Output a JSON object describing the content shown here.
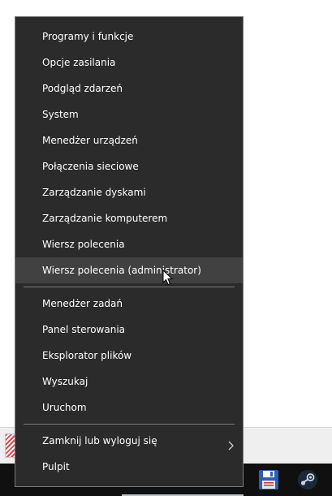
{
  "menu": {
    "group1": [
      {
        "label": "Programy i funkcje"
      },
      {
        "label": "Opcje zasilania"
      },
      {
        "label": "Podgląd zdarzeń"
      },
      {
        "label": "System"
      },
      {
        "label": "Menedżer urządzeń"
      },
      {
        "label": "Połączenia sieciowe"
      },
      {
        "label": "Zarządzanie dyskami"
      },
      {
        "label": "Zarządzanie komputerem"
      },
      {
        "label": "Wiersz polecenia"
      },
      {
        "label": "Wiersz polecenia (administrator)",
        "highlighted": true
      }
    ],
    "group2": [
      {
        "label": "Menedżer zadań"
      },
      {
        "label": "Panel sterowania"
      },
      {
        "label": "Eksplorator plików"
      },
      {
        "label": "Wyszukaj"
      },
      {
        "label": "Uruchom"
      }
    ],
    "group3": [
      {
        "label": "Zamknij lub wyloguj się",
        "has_submenu": true,
        "submenu_icon": "chevron-right-icon"
      },
      {
        "label": "Pulpit"
      }
    ]
  },
  "taskbar": {
    "icons": [
      "save-icon",
      "steam-icon"
    ]
  },
  "colors": {
    "menu_background": "#2b2b2b",
    "menu_highlight": "#414141",
    "menu_text": "#ffffff",
    "separator": "#7a7a7a",
    "taskbar": "#101010"
  }
}
